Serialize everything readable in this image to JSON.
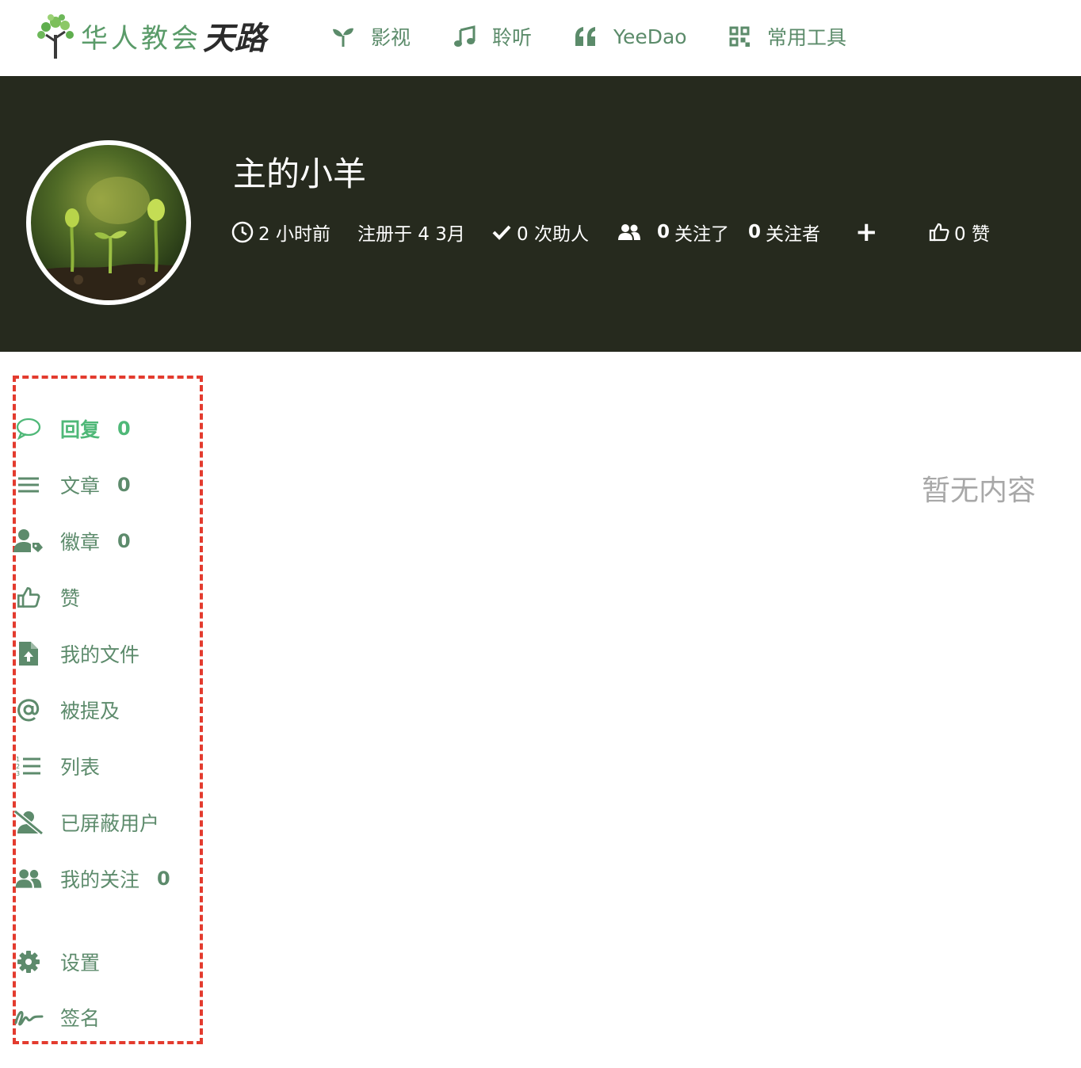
{
  "logo": {
    "text": "华人教会",
    "text_bold": "天路"
  },
  "nav": [
    {
      "label": "影视",
      "icon": "sprout-icon"
    },
    {
      "label": "聆听",
      "icon": "music-note-icon"
    },
    {
      "label": "YeeDao",
      "icon": "quote-icon"
    },
    {
      "label": "常用工具",
      "icon": "qrcode-icon"
    }
  ],
  "profile": {
    "name": "主的小羊",
    "last_seen": "2 小时前",
    "registered": "注册于 4 3月",
    "helped": "0 次助人",
    "following_count": "0",
    "following_label": "关注了",
    "followers_count": "0",
    "followers_label": "关注者",
    "follow_button": "+",
    "likes": "0 赞"
  },
  "sidebar": {
    "items": [
      {
        "label": "回复",
        "count": "0",
        "icon": "comment-icon",
        "active": true
      },
      {
        "label": "文章",
        "count": "0",
        "icon": "list-icon"
      },
      {
        "label": "徽章",
        "count": "0",
        "icon": "user-tag-icon"
      },
      {
        "label": "赞",
        "icon": "thumbs-up-icon"
      },
      {
        "label": "我的文件",
        "icon": "file-upload-icon"
      },
      {
        "label": "被提及",
        "icon": "at-icon"
      },
      {
        "label": "列表",
        "icon": "ordered-list-icon"
      },
      {
        "label": "已屏蔽用户",
        "icon": "user-slash-icon"
      },
      {
        "label": "我的关注",
        "count": "0",
        "icon": "users-icon"
      },
      {
        "label": "设置",
        "icon": "gear-icon"
      },
      {
        "label": "签名",
        "icon": "signature-icon"
      }
    ]
  },
  "main": {
    "empty_text": "暂无内容"
  },
  "colors": {
    "accent": "#5b8b6a",
    "active": "#4fb878",
    "banner": "#262a1e",
    "highlight": "#e33b2e"
  }
}
